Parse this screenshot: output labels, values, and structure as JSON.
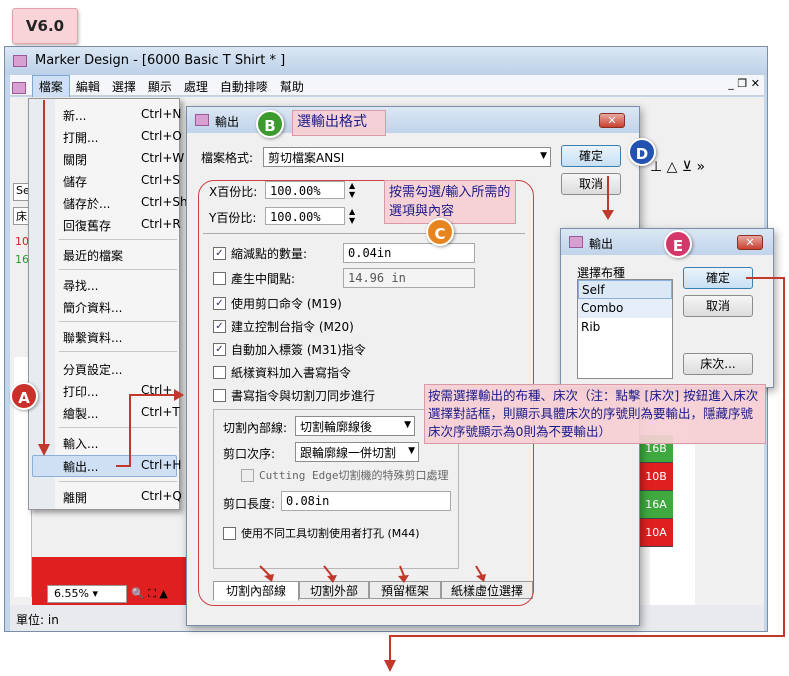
{
  "version_label": "V6.0",
  "main_window": {
    "title": "Marker Design - [6000 Basic T Shirt * ]",
    "menu": [
      "檔案",
      "編輯",
      "選擇",
      "顯示",
      "處理",
      "自動排嘜",
      "幫助"
    ],
    "left_labels": [
      "Se",
      "床",
      "10",
      "16"
    ],
    "zoom_value": "6.55%",
    "status_text": "單位: in"
  },
  "file_menu": {
    "items": [
      {
        "label": "新...",
        "shortcut": "Ctrl+N"
      },
      {
        "label": "打開...",
        "shortcut": "Ctrl+O"
      },
      {
        "label": "關閉",
        "shortcut": "Ctrl+W"
      },
      {
        "label": "儲存",
        "shortcut": "Ctrl+S"
      },
      {
        "label": "儲存於...",
        "shortcut": "Ctrl+Sh"
      },
      {
        "label": "回復舊存",
        "shortcut": "Ctrl+R"
      },
      {
        "label": "最近的檔案",
        "shortcut": ""
      },
      {
        "label": "尋找...",
        "shortcut": ""
      },
      {
        "label": "簡介資料...",
        "shortcut": ""
      },
      {
        "label": "聯繫資料...",
        "shortcut": ""
      },
      {
        "label": "分頁設定...",
        "shortcut": ""
      },
      {
        "label": "打印...",
        "shortcut": "Ctrl+"
      },
      {
        "label": "繪製...",
        "shortcut": "Ctrl+T"
      },
      {
        "label": "輸入...",
        "shortcut": ""
      },
      {
        "label": "輸出...",
        "shortcut": "Ctrl+H"
      },
      {
        "label": "離開",
        "shortcut": "Ctrl+Q"
      }
    ]
  },
  "output_dialog": {
    "title": "輸出",
    "file_format_label": "檔案格式:",
    "file_format_value": "剪切檔案ANSI",
    "ok_label": "確定",
    "cancel_label": "取消",
    "x_percent_label": "X百份比:",
    "x_percent_value": "100.00%",
    "y_percent_label": "Y百份比:",
    "y_percent_value": "100.00%",
    "options": [
      {
        "label": "縮減點的數量:",
        "checked": true,
        "value": "0.04in",
        "disabled": false
      },
      {
        "label": "產生中間點:",
        "checked": false,
        "value": "14.96 in",
        "disabled": true
      },
      {
        "label": "使用剪口命令 (M19)",
        "checked": true
      },
      {
        "label": "建立控制台指令 (M20)",
        "checked": true
      },
      {
        "label": "自動加入標簽 (M31)指令",
        "checked": true
      },
      {
        "label": "紙樣資料加入書寫指令",
        "checked": false
      },
      {
        "label": "書寫指令與切割刀同步進行",
        "checked": false
      }
    ],
    "cut_inner_label": "切割內部線:",
    "cut_inner_value": "切割輪廓線後",
    "notch_order_label": "剪口次序:",
    "notch_order_value": "跟輪廓線一併切割",
    "cutting_edge_label": "Cutting Edge切割機的特殊剪口處理",
    "notch_length_label": "剪口長度:",
    "notch_length_value": "0.08in",
    "punch_label": "使用不同工具切割使用者打孔 (M44)",
    "tabs": [
      "切割內部線",
      "切割外部",
      "預留框架",
      "紙樣虛位選擇"
    ]
  },
  "output_dialog2": {
    "title": "輸出",
    "list_label": "選擇布種",
    "fabrics": [
      "Self",
      "Combo",
      "Rib"
    ],
    "ok_label": "確定",
    "cancel_label": "取消",
    "layer_button": "床次..."
  },
  "annotations": {
    "A": "A",
    "B": "B",
    "C": "C",
    "D": "D",
    "E": "E",
    "b_text": "選輸出格式",
    "c_text": "按需勾選/輸入所需的選項與內容",
    "e_text": "按需選擇輸出的布種、床次（注：點擊 [床次] 按鈕進入床次選擇對話框，則顯示具體床次的序號則為要輸出，隱藏序號床次序號顯示為0則為不要輸出）"
  },
  "marker_cells": [
    "16B",
    "10B",
    "16A",
    "10A"
  ],
  "colors": {
    "accent_red": "#c0392b",
    "circle_a": "#c9302c",
    "circle_b": "#3d9a2e",
    "circle_c": "#e8841e",
    "circle_d": "#2352b0",
    "circle_e": "#d4386a"
  }
}
